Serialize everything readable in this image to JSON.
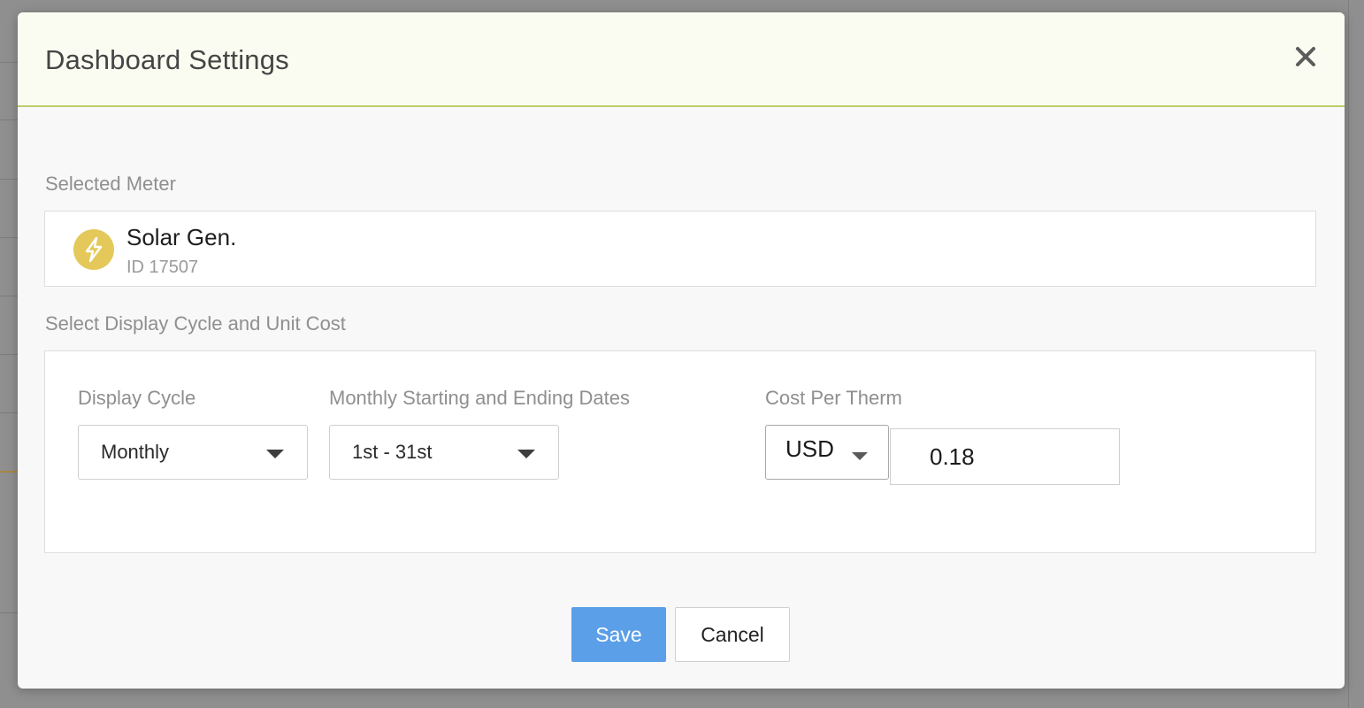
{
  "dialog": {
    "title": "Dashboard Settings",
    "close_icon": "close-icon"
  },
  "selected_meter": {
    "section_label": "Selected Meter",
    "icon": "lightning-bolt-icon",
    "icon_color": "#e4c95a",
    "name": "Solar Gen.",
    "id_text": "ID 17507"
  },
  "cycle_section": {
    "section_label": "Select Display Cycle and Unit Cost",
    "display_cycle": {
      "label": "Display Cycle",
      "value": "Monthly"
    },
    "date_range": {
      "label": "Monthly Starting and Ending Dates",
      "value": "1st - 31st"
    },
    "cost": {
      "label": "Cost Per Therm",
      "currency": "USD",
      "value": "0.18"
    }
  },
  "actions": {
    "save_label": "Save",
    "cancel_label": "Cancel",
    "save_color": "#5b9fe8"
  },
  "theme": {
    "header_bg": "#fbfcf1",
    "header_border": "#bccd6b"
  }
}
